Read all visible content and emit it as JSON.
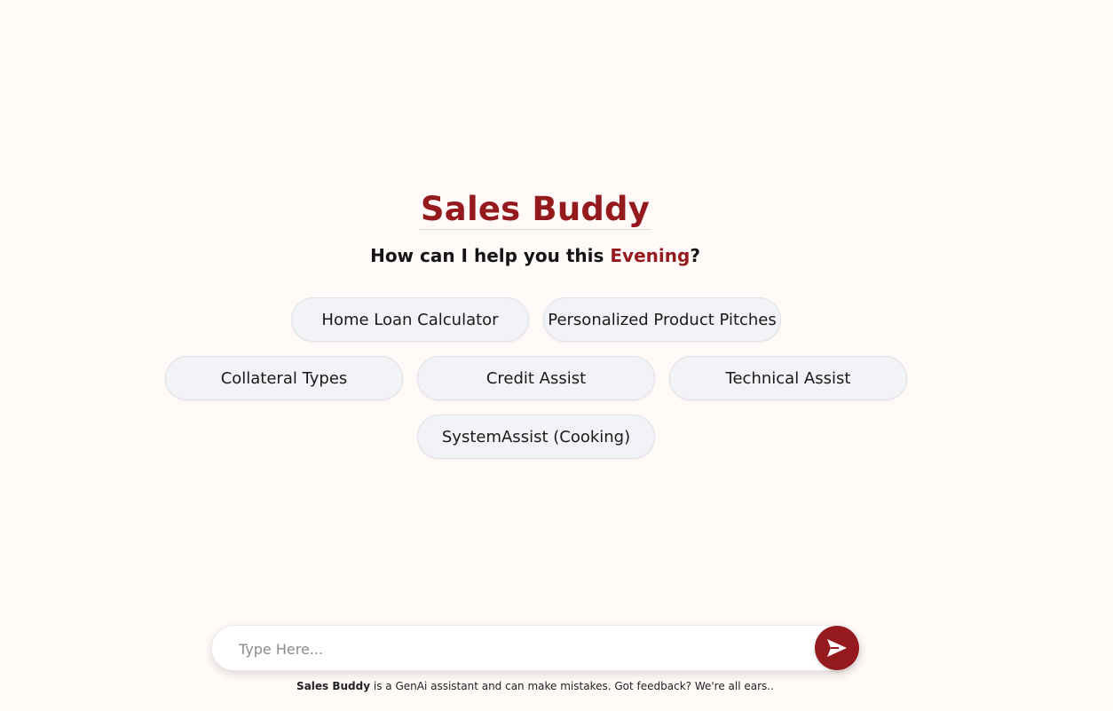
{
  "header": {
    "title": "Sales Buddy",
    "greeting_prefix": "How can I help you this ",
    "greeting_time": "Evening",
    "greeting_suffix": "?"
  },
  "suggestions": [
    {
      "label": "Home Loan Calculator"
    },
    {
      "label": "Personalized Product Pitches"
    },
    {
      "label": "Collateral Types"
    },
    {
      "label": "Credit Assist"
    },
    {
      "label": "Technical Assist"
    },
    {
      "label": "SystemAssist (Cooking)"
    }
  ],
  "chat": {
    "placeholder": "Type Here...",
    "value": "",
    "send_icon": "send-icon"
  },
  "footer": {
    "brand": "Sales Buddy",
    "disclaimer": " is a GenAi assistant and can make mistakes. Got feedback? We're all ears.."
  },
  "colors": {
    "accent": "#951a1d",
    "background": "#fff9f8",
    "pill_background": "#f1f3f6"
  }
}
